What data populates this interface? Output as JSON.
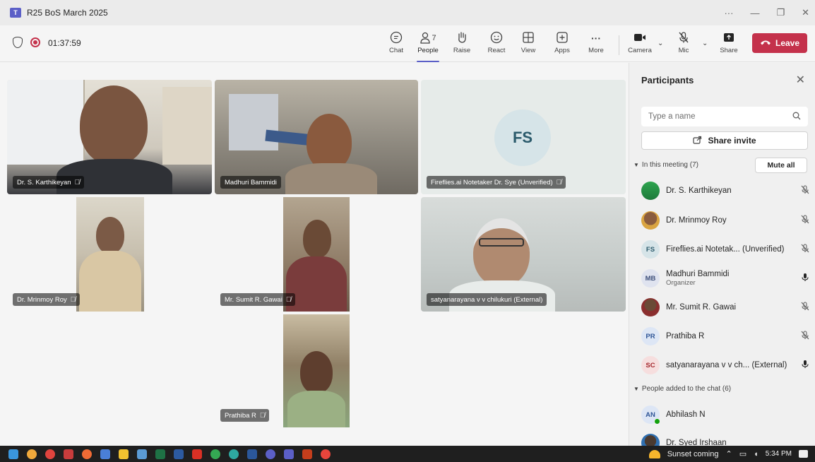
{
  "window": {
    "title": "R25 BoS March 2025",
    "controls": [
      "···",
      "—",
      "❐",
      "✕"
    ]
  },
  "toolbar": {
    "timer": "01:37:59",
    "buttons": {
      "chat": "Chat",
      "people": "People",
      "people_count": "7",
      "raise": "Raise",
      "react": "React",
      "view": "View",
      "apps": "Apps",
      "more": "More",
      "camera": "Camera",
      "mic": "Mic",
      "share": "Share"
    },
    "leave": "Leave",
    "accent_color": "#5b5fc7",
    "leave_color": "#c4314b"
  },
  "tiles": [
    {
      "name": "Dr. S. Karthikeyan",
      "muted": true
    },
    {
      "name": "Madhuri Bammidi",
      "muted": false
    },
    {
      "name": "Fireflies.ai Notetaker Dr. Sye (Unverified)",
      "muted": true,
      "initials": "FS"
    },
    {
      "name": "Dr. Mrinmoy Roy",
      "muted": true
    },
    {
      "name": "Mr. Sumit R. Gawai",
      "muted": true
    },
    {
      "name": "satyanarayana v v chilukuri (External)",
      "muted": false
    },
    {
      "name": "Prathiba R",
      "muted": true
    }
  ],
  "panel": {
    "title": "Participants",
    "search_placeholder": "Type a name",
    "share_invite": "Share invite",
    "in_meeting_label": "In this meeting (7)",
    "mute_all": "Mute all",
    "in_meeting": [
      {
        "name": "Dr. S. Karthikeyan",
        "initials": "",
        "mic": "off"
      },
      {
        "name": "Dr. Mrinmoy Roy",
        "initials": "",
        "mic": "off"
      },
      {
        "name": "Fireflies.ai Notetak... (Unverified)",
        "initials": "FS",
        "mic": "off"
      },
      {
        "name": "Madhuri Bammidi",
        "sub": "Organizer",
        "initials": "MB",
        "mic": "on"
      },
      {
        "name": "Mr. Sumit R. Gawai",
        "initials": "",
        "mic": "off"
      },
      {
        "name": "Prathiba R",
        "initials": "PR",
        "mic": "off"
      },
      {
        "name": "satyanarayana v v ch... (External)",
        "initials": "SC",
        "mic": "on"
      }
    ],
    "chat_label": "People added to the chat (6)",
    "chat_people": [
      {
        "name": "Abhilash N",
        "initials": "AN"
      },
      {
        "name": "Dr. Syed Irshaan",
        "initials": ""
      }
    ]
  },
  "taskbar": {
    "notice": "Sunset coming",
    "time": "5:34 PM"
  }
}
